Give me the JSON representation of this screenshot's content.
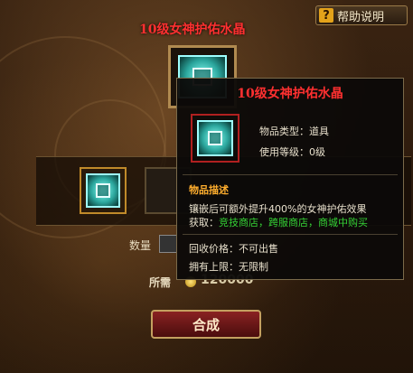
{
  "help": {
    "icon": "?",
    "label": "帮助说明"
  },
  "craft_title": "10级女神护佑水晶",
  "target_slot_icon": "goddess-crystal-icon",
  "materials": {
    "slots": [
      "goddess-crystal-icon",
      "empty-slot",
      "empty-slot",
      "empty-slot"
    ]
  },
  "quantity": {
    "label": "数量"
  },
  "cost": {
    "label": "所需",
    "value": "120000"
  },
  "craft_button": "合成",
  "tooltip": {
    "title": "10级女神护佑水晶",
    "type_label": "物品类型：道具",
    "level_label": "使用等级：0级",
    "desc_header": "物品描述",
    "desc_line1": "镶嵌后可额外提升400%的女神护佑效果",
    "acquire_prefix": "获取：",
    "acquire_value": "竞技商店，跨服商店，商城中购买",
    "recycle": "回收价格：不可出售",
    "limit": "拥有上限：无限制"
  },
  "colors": {
    "title_red": "#ff3030",
    "section_orange": "#ffae2e",
    "acquire_green": "#35d235",
    "gem_teal": "#2ba69d"
  }
}
